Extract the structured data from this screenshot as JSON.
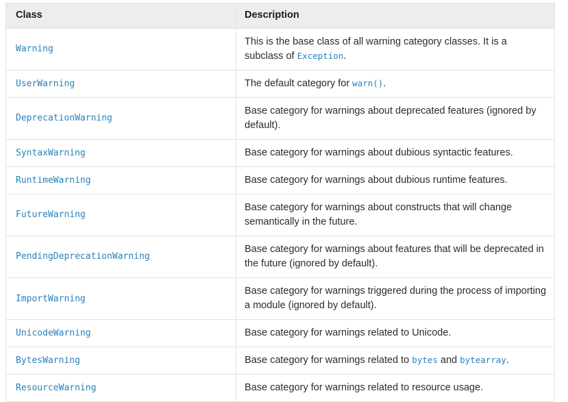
{
  "table": {
    "columns": [
      {
        "key": "class",
        "label": "Class"
      },
      {
        "key": "description",
        "label": "Description"
      }
    ],
    "link_color": "#2980b9",
    "header_background": "#ededed",
    "border_color": "#e1e4e5",
    "text_color": "#2b2b2b",
    "rows": [
      {
        "class": "Warning",
        "description_parts": [
          {
            "type": "text",
            "value": "This is the base class of all warning category classes. It is a subclass of "
          },
          {
            "type": "code",
            "value": "Exception"
          },
          {
            "type": "text",
            "value": "."
          }
        ],
        "description_plain": "This is the base class of all warning category classes. It is a subclass of Exception."
      },
      {
        "class": "UserWarning",
        "description_parts": [
          {
            "type": "text",
            "value": "The default category for "
          },
          {
            "type": "code",
            "value": "warn()"
          },
          {
            "type": "text",
            "value": "."
          }
        ],
        "description_plain": "The default category for warn()."
      },
      {
        "class": "DeprecationWarning",
        "description_parts": [
          {
            "type": "text",
            "value": "Base category for warnings about deprecated features (ignored by default)."
          }
        ],
        "description_plain": "Base category for warnings about deprecated features (ignored by default)."
      },
      {
        "class": "SyntaxWarning",
        "description_parts": [
          {
            "type": "text",
            "value": "Base category for warnings about dubious syntactic features."
          }
        ],
        "description_plain": "Base category for warnings about dubious syntactic features."
      },
      {
        "class": "RuntimeWarning",
        "description_parts": [
          {
            "type": "text",
            "value": "Base category for warnings about dubious runtime features."
          }
        ],
        "description_plain": "Base category for warnings about dubious runtime features."
      },
      {
        "class": "FutureWarning",
        "description_parts": [
          {
            "type": "text",
            "value": "Base category for warnings about constructs that will change semantically in the future."
          }
        ],
        "description_plain": "Base category for warnings about constructs that will change semantically in the future."
      },
      {
        "class": "PendingDeprecationWarning",
        "description_parts": [
          {
            "type": "text",
            "value": "Base category for warnings about features that will be deprecated in the future (ignored by default)."
          }
        ],
        "description_plain": "Base category for warnings about features that will be deprecated in the future (ignored by default)."
      },
      {
        "class": "ImportWarning",
        "description_parts": [
          {
            "type": "text",
            "value": "Base category for warnings triggered during the process of importing a module (ignored by default)."
          }
        ],
        "description_plain": "Base category for warnings triggered during the process of importing a module (ignored by default)."
      },
      {
        "class": "UnicodeWarning",
        "description_parts": [
          {
            "type": "text",
            "value": "Base category for warnings related to Unicode."
          }
        ],
        "description_plain": "Base category for warnings related to Unicode."
      },
      {
        "class": "BytesWarning",
        "description_parts": [
          {
            "type": "text",
            "value": "Base category for warnings related to "
          },
          {
            "type": "code",
            "value": "bytes"
          },
          {
            "type": "text",
            "value": " and "
          },
          {
            "type": "code",
            "value": "bytearray"
          },
          {
            "type": "text",
            "value": "."
          }
        ],
        "description_plain": "Base category for warnings related to bytes and bytearray."
      },
      {
        "class": "ResourceWarning",
        "description_parts": [
          {
            "type": "text",
            "value": "Base category for warnings related to resource usage."
          }
        ],
        "description_plain": "Base category for warnings related to resource usage."
      }
    ]
  }
}
